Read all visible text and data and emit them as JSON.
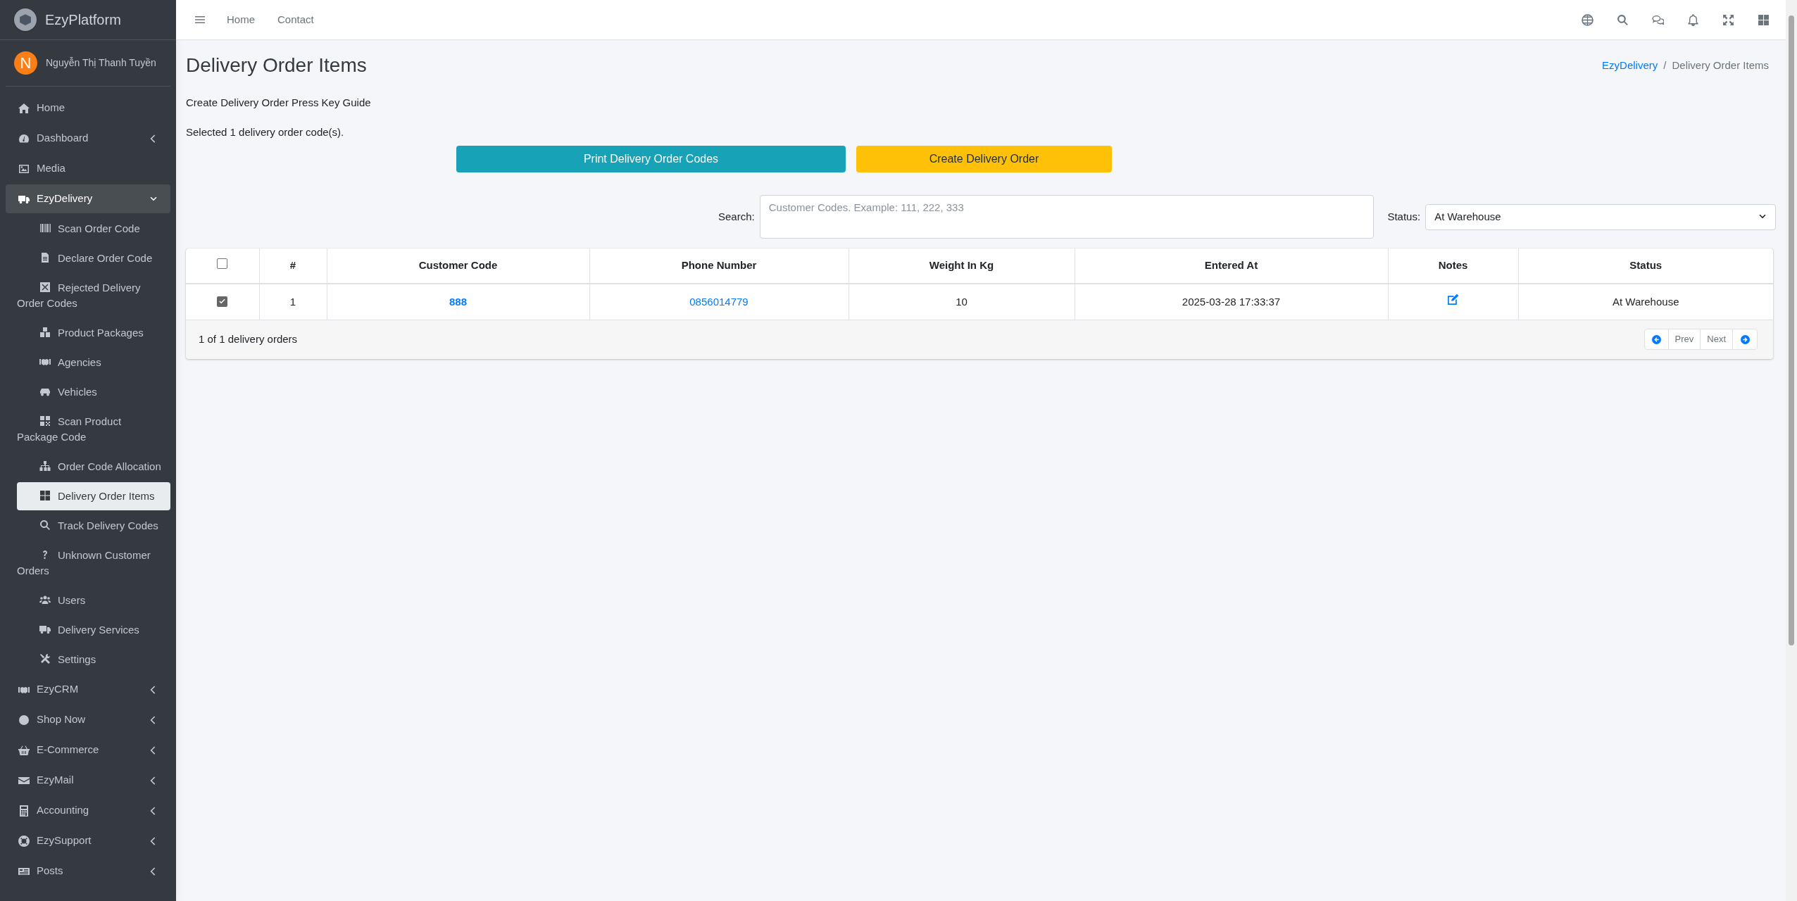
{
  "sidebar": {
    "brand": "EzyPlatform",
    "user": {
      "initial": "N",
      "name": "Nguyễn Thị Thanh Tuyền"
    },
    "items": [
      {
        "label": "Home",
        "selected": false
      },
      {
        "label": "Dashboard",
        "selected": false,
        "expanded": false
      },
      {
        "label": "Media",
        "selected": false
      },
      {
        "label": "EzyDelivery",
        "selected": true,
        "expanded": true,
        "children": [
          {
            "label": "Scan Order Code",
            "selected": false
          },
          {
            "label": "Declare Order Code",
            "selected": false
          },
          {
            "label": "Rejected Delivery Order Codes",
            "selected": false
          },
          {
            "label": "Product Packages",
            "selected": false
          },
          {
            "label": "Agencies",
            "selected": false
          },
          {
            "label": "Vehicles",
            "selected": false
          },
          {
            "label": "Scan Product Package Code",
            "selected": false
          },
          {
            "label": "Order Code Allocation",
            "selected": false
          },
          {
            "label": "Delivery Order Items",
            "selected": true
          },
          {
            "label": "Track Delivery Codes",
            "selected": false
          },
          {
            "label": "Unknown Customer Orders",
            "selected": false
          },
          {
            "label": "Users",
            "selected": false
          },
          {
            "label": "Delivery Services",
            "selected": false
          },
          {
            "label": "Settings",
            "selected": false
          }
        ]
      },
      {
        "label": "EzyCRM",
        "selected": false,
        "expanded": false
      },
      {
        "label": "Shop Now",
        "selected": false,
        "expanded": false
      },
      {
        "label": "E-Commerce",
        "selected": false,
        "expanded": false
      },
      {
        "label": "EzyMail",
        "selected": false,
        "expanded": false
      },
      {
        "label": "Accounting",
        "selected": false,
        "expanded": false
      },
      {
        "label": "EzySupport",
        "selected": false,
        "expanded": false
      },
      {
        "label": "Posts",
        "selected": false,
        "expanded": false
      }
    ]
  },
  "topbar": {
    "links": [
      "Home",
      "Contact"
    ]
  },
  "page": {
    "title": "Delivery Order Items",
    "breadcrumb": [
      "EzyDelivery",
      "Delivery Order Items"
    ],
    "breadcrumb_separator": "/",
    "guide": "Create Delivery Order Press Key Guide",
    "selection_note": "Selected 1 delivery order code(s).",
    "buttons": [
      {
        "label": "Print Delivery Order Codes",
        "kind": "info"
      },
      {
        "label": "Create Delivery Order",
        "kind": "warning"
      }
    ],
    "search": {
      "label": "Search:",
      "placeholder": "Customer Codes. Example: 111, 222, 333"
    },
    "status_filter": {
      "label": "Status:",
      "value": "At Warehouse"
    }
  },
  "table": {
    "select_all_checked": false,
    "columns": [
      "#",
      "Customer Code",
      "Phone Number",
      "Weight In Kg",
      "Entered At",
      "Notes",
      "Status"
    ],
    "rows": [
      {
        "checked": true,
        "index": "1",
        "customer_code": "888",
        "phone": "0856014779",
        "weight": "10",
        "entered_at": "2025-03-28 17:33:37",
        "status": "At Warehouse"
      }
    ],
    "summary": "1 of 1 delivery orders",
    "pager": [
      "Prev",
      "Next"
    ]
  }
}
